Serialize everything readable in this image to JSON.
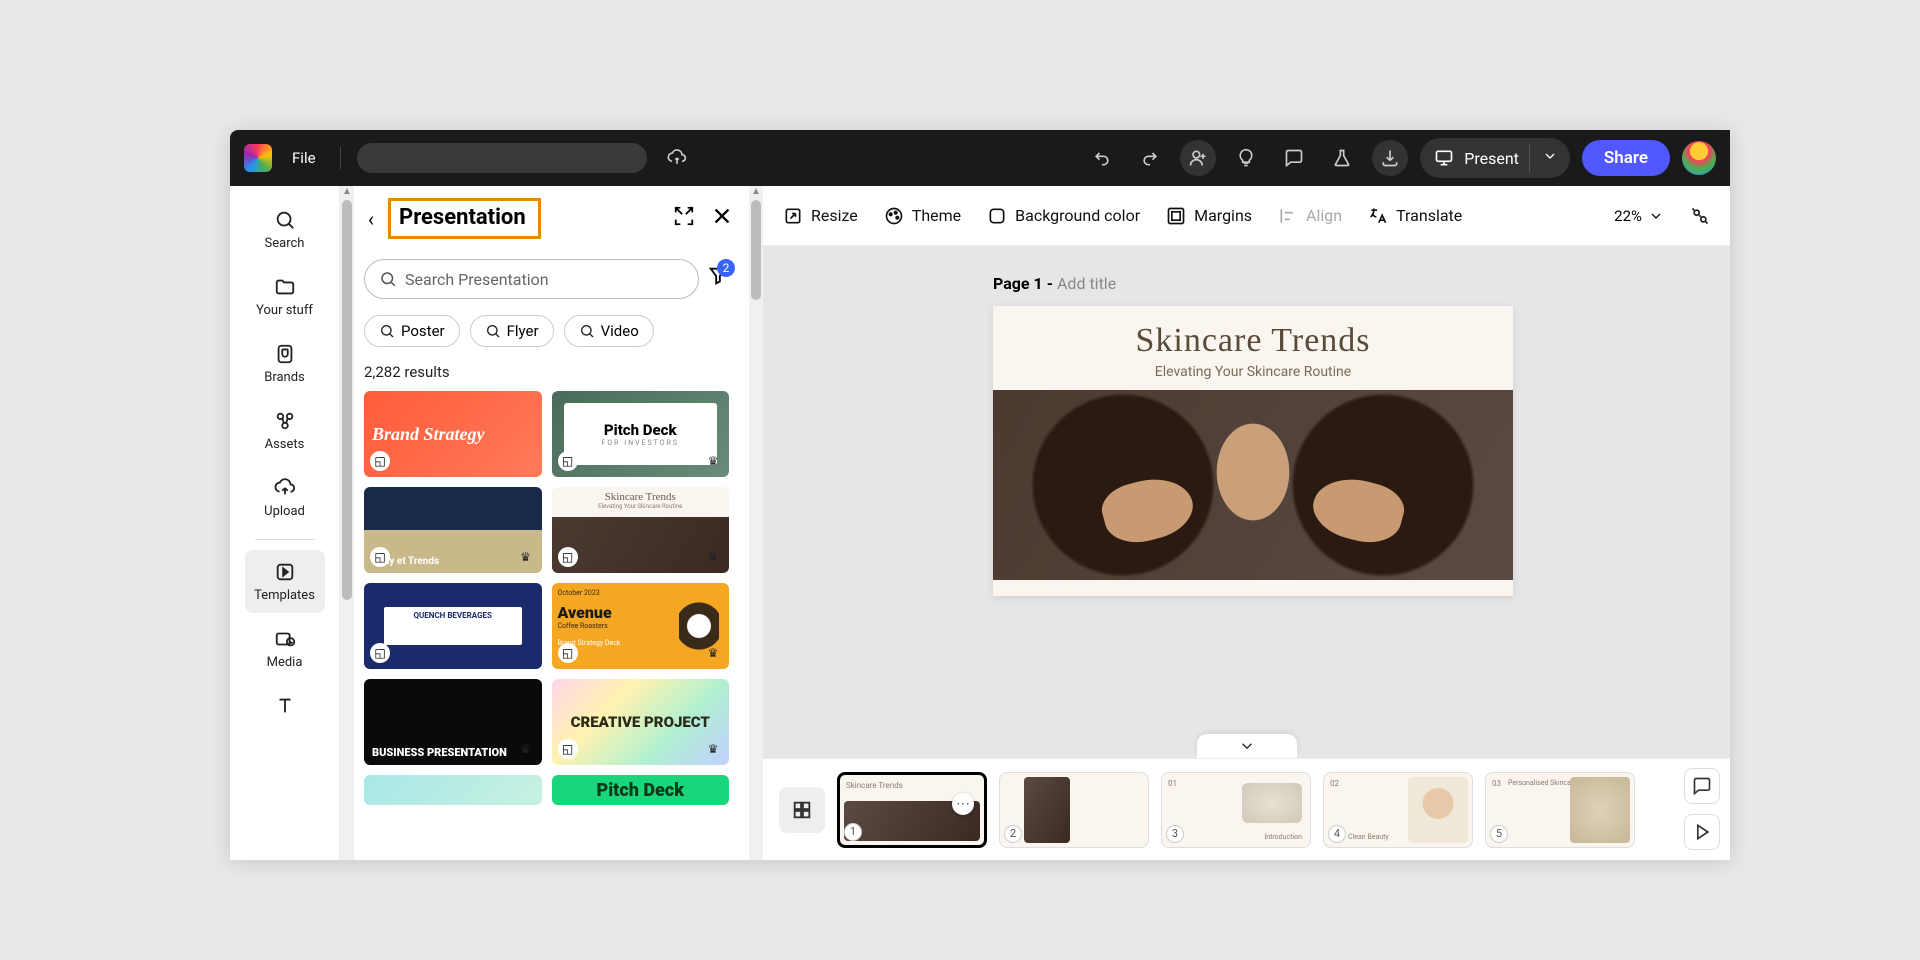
{
  "topbar": {
    "file": "File",
    "present": "Present",
    "share": "Share"
  },
  "rail": {
    "search": "Search",
    "your_stuff": "Your stuff",
    "brands": "Brands",
    "assets": "Assets",
    "upload": "Upload",
    "templates": "Templates",
    "media": "Media"
  },
  "panel": {
    "title": "Presentation",
    "search_placeholder": "Search Presentation",
    "filter_badge": "2",
    "chips": {
      "poster": "Poster",
      "flyer": "Flyer",
      "video": "Video"
    },
    "results": "2,282 results",
    "cards": {
      "c0": "Brand Strategy",
      "c1": "Pitch Deck",
      "c1b": "FOR INVESTORS",
      "c2": "tality et Trends",
      "c3": "Skincare Trends",
      "c3b": "Elevating Your Skincare Routine",
      "c4": "QUENCH BEVERAGES",
      "c5a": "October 2023",
      "c5b": "Avenue",
      "c5c": "Coffee Roasters",
      "c5d": "Brand Strategy Deck",
      "c6": "BUSINESS PRESENTATION",
      "c7": "CREATIVE PROJECT",
      "c9": "Pitch Deck"
    }
  },
  "toolbar": {
    "resize": "Resize",
    "theme": "Theme",
    "bg": "Background color",
    "margins": "Margins",
    "align": "Align",
    "translate": "Translate",
    "zoom": "22%"
  },
  "stage": {
    "page_prefix": "Page 1 - ",
    "page_hint": "Add title",
    "slide_title": "Skincare Trends",
    "slide_sub": "Elevating Your Skincare Routine"
  },
  "thumbs": {
    "n1": "1",
    "n2": "2",
    "n3": "3",
    "n4": "4",
    "n5": "5",
    "t1": "Skincare Trends",
    "t3a": "01",
    "t4a": "02",
    "t5a": "03",
    "t3b": "Introduction",
    "t4b": "Clean Beauty",
    "t5b": "Personalised Skincare"
  }
}
